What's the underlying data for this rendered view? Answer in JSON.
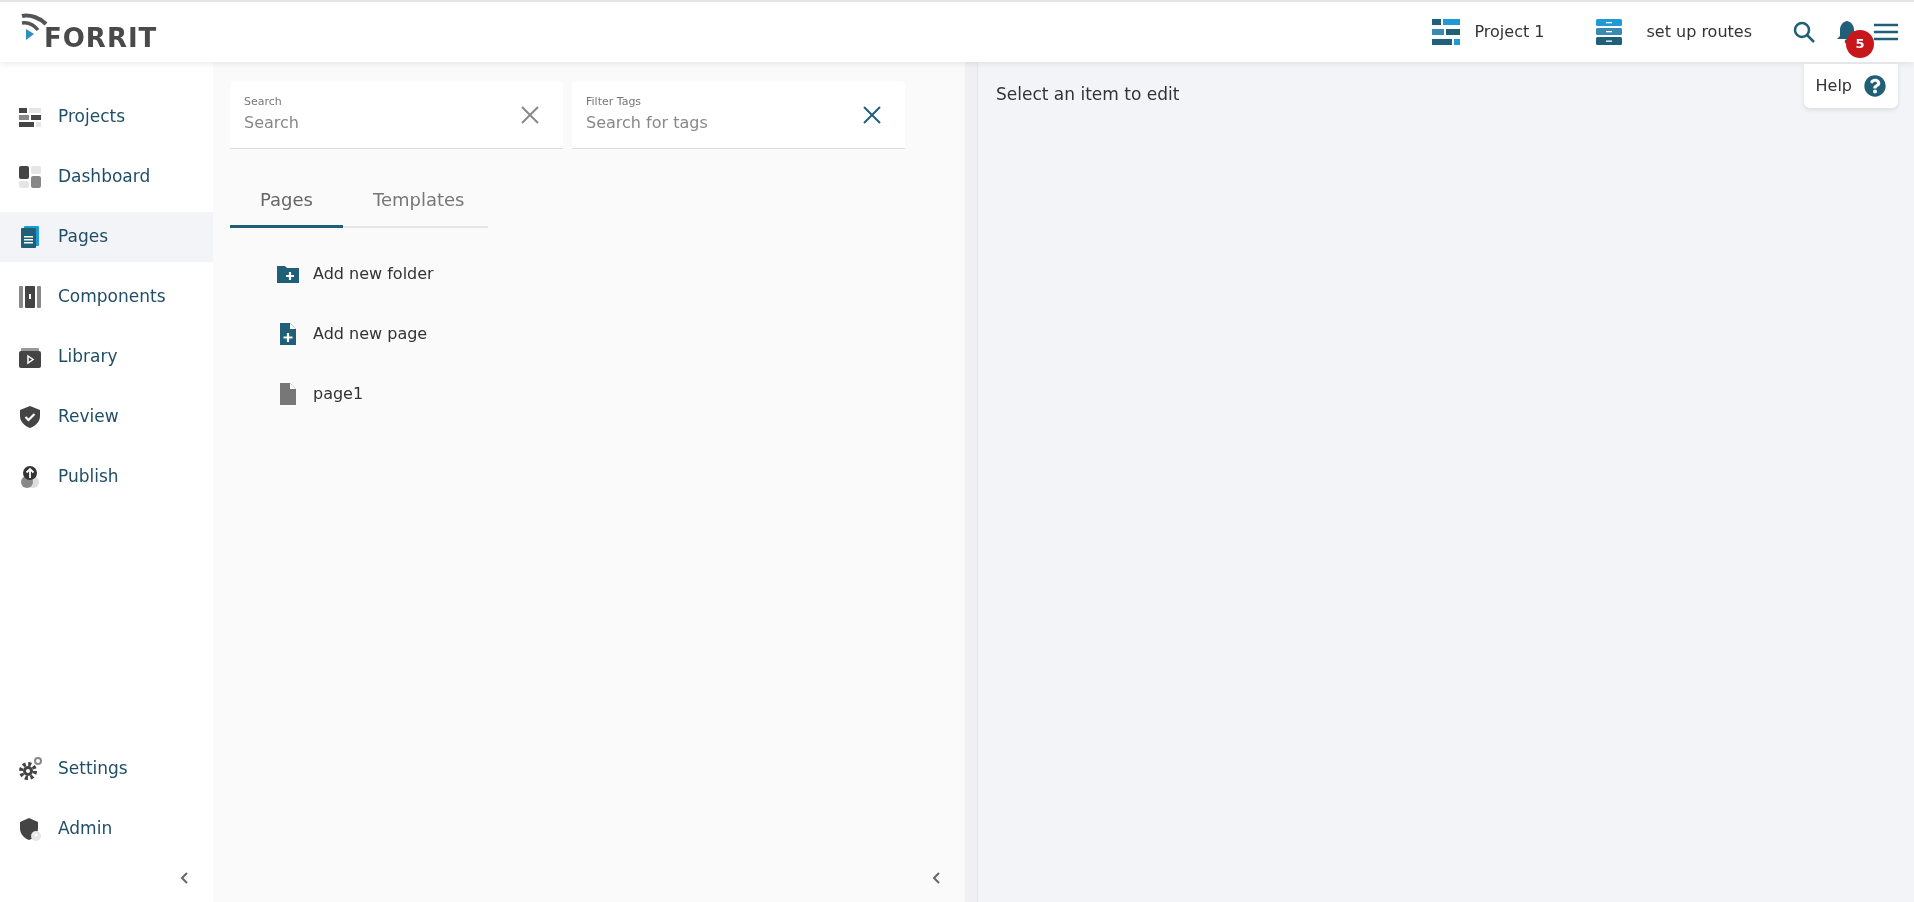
{
  "header": {
    "logo": "FORRIT",
    "project": "Project 1",
    "route": "set up routes",
    "notification_count": "5",
    "help": "Help"
  },
  "sidebar": {
    "items": [
      {
        "label": "Projects",
        "kind": "projects",
        "selected": false
      },
      {
        "label": "Dashboard",
        "kind": "dashboard",
        "selected": false
      },
      {
        "label": "Pages",
        "kind": "pages",
        "selected": true
      },
      {
        "label": "Components",
        "kind": "components",
        "selected": false
      },
      {
        "label": "Library",
        "kind": "library",
        "selected": false
      },
      {
        "label": "Review",
        "kind": "review",
        "selected": false
      },
      {
        "label": "Publish",
        "kind": "publish",
        "selected": false
      }
    ],
    "bottom_items": [
      {
        "label": "Settings",
        "kind": "settings",
        "selected": false
      },
      {
        "label": "Admin",
        "kind": "admin",
        "selected": false
      }
    ]
  },
  "filters": [
    {
      "label": "Search",
      "placeholder": "Search",
      "kind": "search"
    },
    {
      "label": "Filter Tags",
      "placeholder": "Search for tags",
      "kind": "tags"
    }
  ],
  "tabs": [
    {
      "label": "Pages",
      "selected": true
    },
    {
      "label": "Templates",
      "selected": false
    }
  ],
  "list": [
    {
      "label": "Add new folder",
      "kind": "add-folder"
    },
    {
      "label": "Add new page",
      "kind": "add-page"
    },
    {
      "label": "page1",
      "kind": "page"
    }
  ],
  "editor": {
    "message": "Select an item to edit"
  }
}
